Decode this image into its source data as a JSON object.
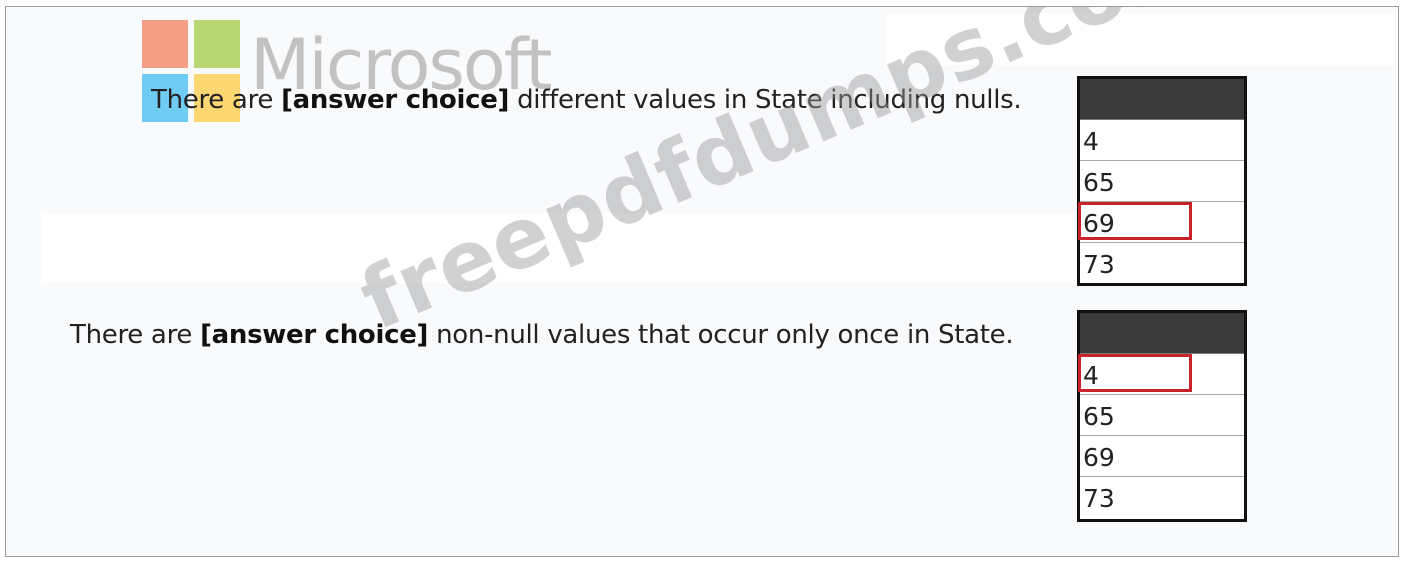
{
  "statement_1": {
    "prefix": "There are ",
    "bold": "[answer choice]",
    "suffix": " different values in State including nulls.",
    "options": [
      "4",
      "65",
      "69",
      "73"
    ],
    "selected": "69"
  },
  "statement_2": {
    "prefix": "There are ",
    "bold": "[answer choice]",
    "suffix": " non-null values that occur only once in State.",
    "options": [
      "4",
      "65",
      "69",
      "73"
    ],
    "selected": "4"
  },
  "watermarks": {
    "logo_text": "Microsoft",
    "overlay_text": "freepdfdumps.com"
  },
  "colors": {
    "selection_box": "#c8232b",
    "table_header": "#3a3a3a",
    "logo_red": "#f25022",
    "logo_green": "#7fba00",
    "logo_blue": "#00a4ef",
    "logo_yellow": "#ffb900"
  }
}
